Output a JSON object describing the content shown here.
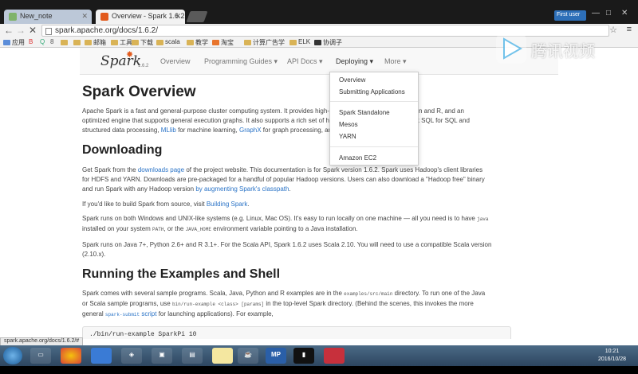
{
  "browser": {
    "tabs": [
      {
        "title": "New_note"
      },
      {
        "title": "Overview - Spark 1.6.2"
      }
    ],
    "window_badge": "First user",
    "url": "spark.apache.org/docs/1.6.2/",
    "bookmarks": [
      "应用",
      "",
      "B",
      "",
      "Q",
      "8",
      "",
      "",
      "邮箱",
      "工具",
      "下载",
      "scala",
      "教学",
      "淘宝",
      "计算广告学",
      "ELK",
      "协调子"
    ]
  },
  "spark_nav": {
    "logo": "Spark",
    "version": "1.6.2",
    "links": [
      "Overview",
      "Programming Guides ▾",
      "API Docs ▾",
      "Deploying ▾",
      "More ▾"
    ]
  },
  "content": {
    "title": "Spark Overview",
    "intro_1": "Apache Spark is a fast and general-purpose cluster computing system. It provides high-level APIs in Java, Scala, Python and R, and an",
    "intro_2": "optimized engine that supports general execution graphs. It also supports a rich set of higher-level tools including Spark SQL for SQL and",
    "intro_3_prefix": "structured data processing, ",
    "intro_3_mllib": "MLlib",
    "intro_3_mid": " for machine learning, ",
    "intro_3_graphx": "GraphX",
    "intro_3_suffix": " for graph processing, and Spark Streaming.",
    "h_downloading": "Downloading",
    "dl_1_prefix": "Get Spark from the ",
    "dl_1_link": "downloads page",
    "dl_1_suffix": " of the project website. This documentation is for Spark version 1.6.2. Spark uses Hadoop's client libraries",
    "dl_2": "for HDFS and YARN. Downloads are pre-packaged for a handful of popular Hadoop versions. Users can also download a \"Hadoop free\" binary",
    "dl_3_prefix": "and run Spark with any Hadoop version ",
    "dl_3_link": "by augmenting Spark's classpath",
    "dl_3_suffix": ".",
    "build_prefix": "If you'd like to build Spark from source, visit ",
    "build_link": "Building Spark",
    "build_suffix": ".",
    "os_1_prefix": "Spark runs on both Windows and UNIX-like systems (e.g. Linux, Mac OS). It's easy to run locally on one machine — all you need is to have ",
    "os_1_code": "java",
    "os_2_prefix": "installed on your system ",
    "os_2_code1": "PATH",
    "os_2_mid": ", or the ",
    "os_2_code2": "JAVA_HOME",
    "os_2_suffix": " environment variable pointing to a Java installation.",
    "java_1": "Spark runs on Java 7+, Python 2.6+ and R 3.1+. For the Scala API, Spark 1.6.2 uses Scala 2.10. You will need to use a compatible Scala version",
    "java_2": "(2.10.x).",
    "h_running": "Running the Examples and Shell",
    "run_1_prefix": "Spark comes with several sample programs. Scala, Java, Python and R examples are in the ",
    "run_1_code": "examples/src/main",
    "run_1_suffix": " directory. To run one of the Java",
    "run_2_prefix": "or Scala sample programs, use ",
    "run_2_code": "bin/run-example <class> [params]",
    "run_2_suffix": " in the top-level Spark directory. (Behind the scenes, this invokes the more",
    "run_3_prefix": "general ",
    "run_3_link": "spark-submit",
    "run_3_link2": " script",
    "run_3_suffix": " for launching applications). For example,",
    "code": "./bin/run-example SparkPi 10"
  },
  "dropdown": {
    "items": [
      "Overview",
      "Submitting Applications",
      "Spark Standalone",
      "Mesos",
      "YARN",
      "Amazon EC2"
    ]
  },
  "watermark": "腾讯视频",
  "status_url": "spark.apache.org/docs/1.6.2/#",
  "taskbar": {
    "mp_label": "MP",
    "time": "10:21",
    "date": "2016/10/28"
  }
}
